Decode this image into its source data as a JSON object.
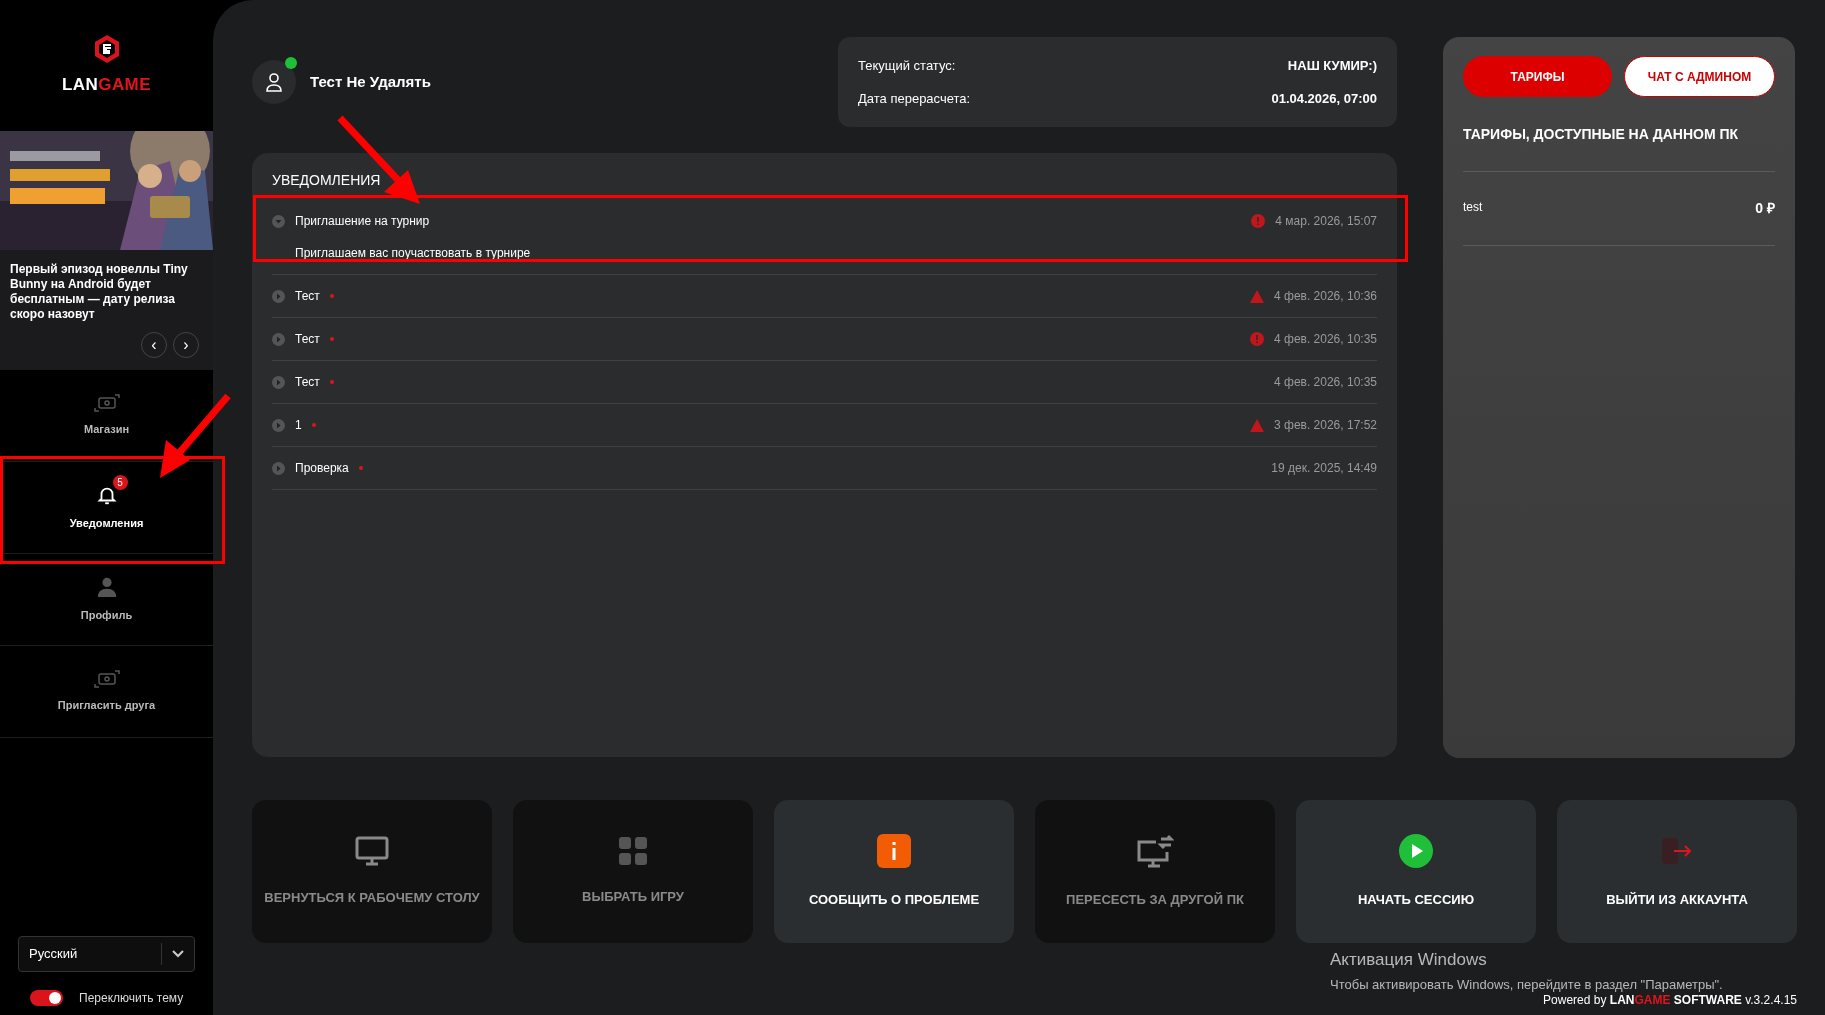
{
  "sidebar": {
    "logo": {
      "part_1": "LAN",
      "part_2": "GAME"
    },
    "news": {
      "text": "Первый эпизод новеллы Tiny Bunny на Android будет бесплатным — дату релиза скоро назовут",
      "prev": "‹",
      "next": "›"
    },
    "items": [
      {
        "label": "Магазин",
        "kind": "money",
        "selected": false
      },
      {
        "label": "Уведомления",
        "kind": "bell",
        "selected": true,
        "badge": "5"
      },
      {
        "label": "Профиль",
        "kind": "person",
        "selected": false
      },
      {
        "label": "Пригласить друга",
        "kind": "money",
        "selected": false
      }
    ],
    "language": {
      "value": "Русский"
    },
    "theme_toggle": {
      "label": "Переключить тему",
      "on": true
    }
  },
  "user": {
    "name": "Тест Не Удалять",
    "online": true
  },
  "status": [
    {
      "label": "Текущий статус:",
      "value": "НАШ КУМИР:)"
    },
    {
      "label": "Дата перерасчета:",
      "value": "01.04.2026, 07:00"
    }
  ],
  "notifications": {
    "title": "УВЕДОМЛЕНИЯ",
    "items": [
      {
        "title": "Приглашение на турнир",
        "body": "Приглашаем вас поучаствовать в турнире",
        "expanded": true,
        "unread": false,
        "kind": "info",
        "date": "4 мар. 2026, 15:07"
      },
      {
        "title": "Тест",
        "expanded": false,
        "unread": true,
        "kind": "warning",
        "date": "4 фев. 2026, 10:36"
      },
      {
        "title": "Тест",
        "expanded": false,
        "unread": true,
        "kind": "info",
        "date": "4 фев. 2026, 10:35"
      },
      {
        "title": "Тест",
        "expanded": false,
        "unread": true,
        "kind": "plain",
        "date": "4 фев. 2026, 10:35"
      },
      {
        "title": "1",
        "expanded": false,
        "unread": true,
        "kind": "warning",
        "date": "3 фев. 2026, 17:52"
      },
      {
        "title": "Проверка",
        "expanded": false,
        "unread": true,
        "kind": "plain",
        "date": "19 дек. 2025, 14:49"
      }
    ]
  },
  "tariffs_panel": {
    "tabs": [
      {
        "label": "ТАРИФЫ",
        "selected": true
      },
      {
        "label": "ЧАТ С АДМИНОМ",
        "selected": false
      }
    ],
    "heading": "ТАРИФЫ, ДОСТУПНЫЕ НА ДАННОМ ПК",
    "rows": [
      {
        "name": "test",
        "price": "0 ₽"
      }
    ]
  },
  "actions": [
    {
      "label": "ВЕРНУТЬСЯ К РАБОЧЕМУ СТОЛУ",
      "kind": "monitor",
      "disabled": true
    },
    {
      "label": "ВЫБРАТЬ ИГРУ",
      "kind": "grid",
      "disabled": true
    },
    {
      "label": "СООБЩИТЬ О ПРОБЛЕМЕ",
      "kind": "info",
      "disabled": false
    },
    {
      "label": "ПЕРЕСЕСТЬ ЗА ДРУГОЙ ПК",
      "kind": "switch",
      "disabled": true
    },
    {
      "label": "НАЧАТЬ СЕССИЮ",
      "kind": "play",
      "disabled": false
    },
    {
      "label": "ВЫЙТИ ИЗ АККАУНТА",
      "kind": "logout",
      "disabled": false
    }
  ],
  "windows_activation": {
    "title": "Активация Windows",
    "text": "Чтобы активировать Windows, перейдите в раздел \"Параметры\"."
  },
  "footer": {
    "powered": "Powered by",
    "brand_1": "LAN",
    "brand_2": "GAME",
    "brand_3": "SOFTWARE",
    "version": "v.3.2.4.15"
  }
}
